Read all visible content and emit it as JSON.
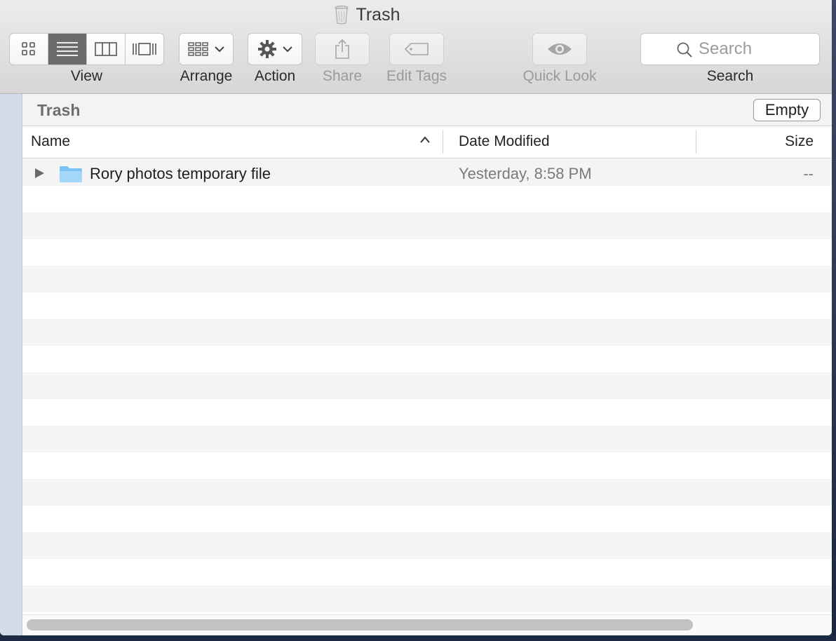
{
  "window": {
    "title": "Trash"
  },
  "toolbar": {
    "view_label": "View",
    "arrange_label": "Arrange",
    "action_label": "Action",
    "share_label": "Share",
    "edit_tags_label": "Edit Tags",
    "quick_look_label": "Quick Look",
    "search_label": "Search",
    "search_placeholder": "Search",
    "active_view": "list"
  },
  "pathbar": {
    "location": "Trash",
    "empty_label": "Empty"
  },
  "columns": {
    "name": "Name",
    "date_modified": "Date Modified",
    "size": "Size",
    "sort": "ascending"
  },
  "files": [
    {
      "name": "Rory photos temporary file",
      "date_modified": "Yesterday, 8:58 PM",
      "size": "--",
      "kind": "folder"
    }
  ],
  "colors": {
    "folder": "#8ecdf5",
    "active_segment": "#6b6b6b",
    "sidebar": "#d4dcea"
  }
}
